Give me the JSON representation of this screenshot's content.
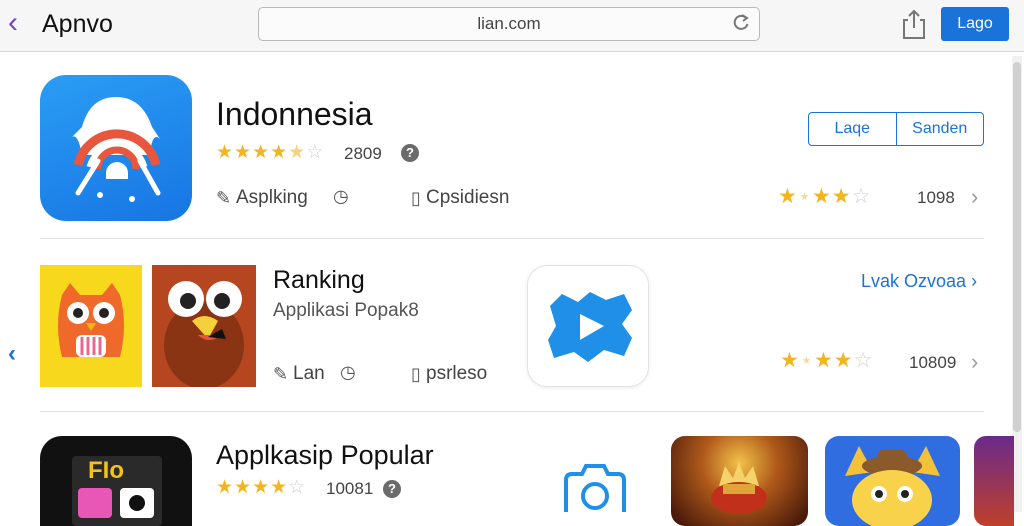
{
  "topbar": {
    "back_glyph": "‹",
    "app_title": "Apnvo",
    "url": "lian.com",
    "login_label": "Lago"
  },
  "icons": [
    "back-icon",
    "reload-icon",
    "share-icon",
    "info-icon",
    "chevron-right-icon",
    "camera-icon",
    "nav-left-icon"
  ],
  "colors": {
    "accent": "#1a73d9",
    "star": "#f3b51d",
    "title_green": "#2fa63c"
  },
  "section1": {
    "title": "Indonnesia",
    "rating_count": "2809",
    "info_glyph": "?",
    "meta1": "Asplking",
    "meta2": "Cpsidiesn",
    "seg_left": "Laqe",
    "seg_right": "Sanden",
    "row_count": "1098",
    "stars": 4.5,
    "row_stars": 3.5
  },
  "section2": {
    "title": "Ranking",
    "subtitle": "Applikasi Popak8",
    "meta1": "Lan",
    "meta2": "psrleso",
    "link": "Lvak Ozvoaa",
    "row_count": "10809",
    "row_stars": 3.5
  },
  "section3": {
    "title": "Applkasip Popular",
    "rating_count": "10081",
    "info_glyph": "?",
    "stars": 4.5,
    "dark_tile_text": "FIo"
  }
}
